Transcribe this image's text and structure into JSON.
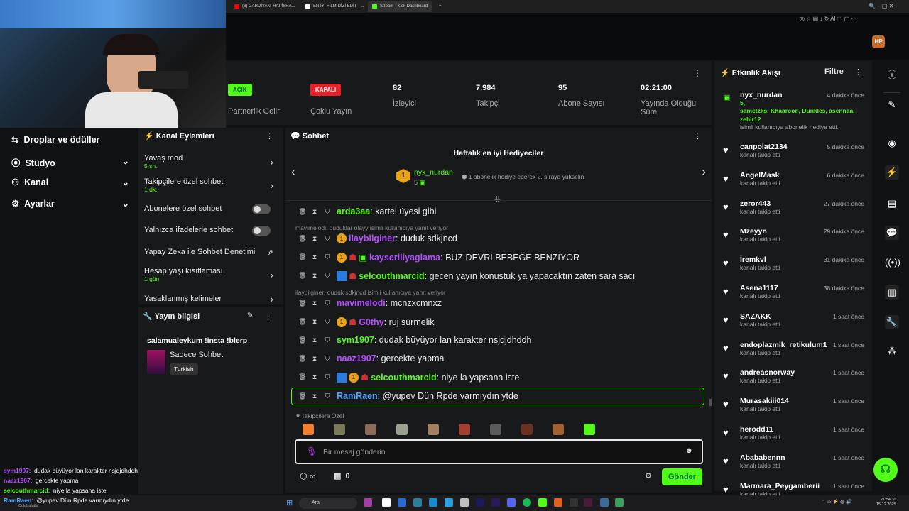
{
  "browser": {
    "tabs": [
      {
        "label": "(8) GARDİYAN, HAPİSHA...",
        "color": "#ff0000"
      },
      {
        "label": "EN İYİ FİLM-DİZİ EDİT - ...",
        "color": "#ffffff"
      },
      {
        "label": "Stream - Kick Dashboard",
        "color": "#53fc18"
      }
    ],
    "ai": "AI"
  },
  "leftnav": {
    "items": [
      "Droplar ve ödüller",
      "Stüdyo",
      "Kanal",
      "Ayarlar"
    ]
  },
  "stats": [
    {
      "badge": "AÇIK",
      "badge_color": "#53fc18",
      "label": "Partnerlik Gelir"
    },
    {
      "badge": "KAPALI",
      "badge_color": "#e8202a",
      "label": "Çoklu Yayın"
    },
    {
      "value": "82",
      "label": "İzleyici"
    },
    {
      "value": "7.984",
      "label": "Takipçi"
    },
    {
      "value": "95",
      "label": "Abone Sayısı"
    },
    {
      "value": "02:21:00",
      "label": "Yayında Olduğu Süre"
    }
  ],
  "channel_actions": {
    "title": "Kanal Eylemleri",
    "items": [
      {
        "label": "Yavaş mod",
        "sub": "5 sn."
      },
      {
        "label": "Takipçilere özel sohbet",
        "sub": "1 dk."
      },
      {
        "label": "Abonelere özel sohbet"
      },
      {
        "label": "Yalnızca ifadelerle sohbet"
      },
      {
        "label": "Yapay Zeka ile Sohbet Denetimi"
      },
      {
        "label": "Hesap yaşı kısıtlaması",
        "sub": "1 gün"
      },
      {
        "label": "Yasaklanmış kelimeler"
      }
    ]
  },
  "stream_info": {
    "title": "Yayın bilgisi",
    "stream_title": "salamualeykum !insta !blerp",
    "category": "Sadece Sohbet",
    "language": "Turkish"
  },
  "chat": {
    "title": "Sohbet",
    "top_gifters_title": "Haftalık en iyi Hediyeciler",
    "top_gifter": {
      "rank": "1",
      "name": "nyx_nurdan",
      "count": "5",
      "note": "1 abonelik hediye ederek 2. sıraya yükselin"
    },
    "messages": [
      {
        "user": "arda3aa",
        "color": "#53fc18",
        "text": "kartel üyesi gibi"
      },
      {
        "reply": "mavimelodi: duduklar olayy isimli kullanıcıya yanıt veriyor"
      },
      {
        "user": "ilaybilginer",
        "color": "#b44dff",
        "text": "duduk sdkjncd",
        "coin": "1"
      },
      {
        "user": "kayseriliyaglama",
        "color": "#b44dff",
        "text": "BUZ DEVRİ BEBEĞE BENZİYOR",
        "coin": "1"
      },
      {
        "user": "selcouthmarcid",
        "color": "#53fc18",
        "text": "gecen yayın konustuk ya yapacaktın zaten sara sacı"
      },
      {
        "reply": "ilaybilginer: duduk sdkjncd isimli kullanıcıya yanıt veriyor"
      },
      {
        "user": "mavimelodi",
        "color": "#b44dff",
        "text": "mcnzxcmnxz"
      },
      {
        "user": "G0thy",
        "color": "#b44dff",
        "text": "ruj sürmelik",
        "coin": "1"
      },
      {
        "user": "sym1907",
        "color": "#53fc18",
        "text": "dudak büyüyor lan karakter nsjdjdhddh"
      },
      {
        "user": "naaz1907",
        "color": "#b44dff",
        "text": "gercekte yapma"
      },
      {
        "user": "selcouthmarcid",
        "color": "#53fc18",
        "text": "niye la yapsana iste",
        "coin": "1"
      },
      {
        "user": "RamRaen",
        "color": "#4fa3ff",
        "text": "@yupev Dün Rpde varmıydın ytde"
      }
    ],
    "followers_label": "Takipçilere Özel",
    "input_placeholder": "Bir mesaj gönderin",
    "points": "∞",
    "drops": "0",
    "send": "Gönder"
  },
  "activity": {
    "title": "Etkinlik Akışı",
    "filter": "Filtre",
    "gift": {
      "name": "nyx_nurdan",
      "time": "4 dakika önce",
      "count": "5,",
      "recipients": "sametzks, Khaaroon, Dunkles, asennaa, zehir12",
      "text": "isimli kullanıcıya abonelik hediye etti."
    },
    "follows": [
      {
        "name": "canpolat2134",
        "time": "5 dakika önce"
      },
      {
        "name": "AngelMask",
        "time": "6 dakika önce"
      },
      {
        "name": "zeror443",
        "time": "27 dakika önce"
      },
      {
        "name": "Mzeyyn",
        "time": "29 dakika önce"
      },
      {
        "name": "İremkvl",
        "time": "31 dakika önce"
      },
      {
        "name": "Asena1117",
        "time": "38 dakika önce"
      },
      {
        "name": "SAZAKK",
        "time": "1 saat önce"
      },
      {
        "name": "endoplazmik_retikulum1",
        "time": "1 saat önce"
      },
      {
        "name": "andreasnorway",
        "time": "1 saat önce"
      },
      {
        "name": "Murasakiii014",
        "time": "1 saat önce"
      },
      {
        "name": "herodd11",
        "time": "1 saat önce"
      },
      {
        "name": "Abababennn",
        "time": "1 saat önce"
      },
      {
        "name": "Marmara_Peygamberii",
        "time": "1 saat önce"
      }
    ],
    "follow_text": "kanalı takip etti"
  },
  "overlay_chat": [
    {
      "user": "sym1907",
      "color": "#b44dff",
      "text": "dudak büyüyor lan karakter nsjdjdhddh"
    },
    {
      "user": "naaz1907",
      "color": "#b44dff",
      "text": "gercekte yapma"
    },
    {
      "user": "selcouthmarcid",
      "color": "#53fc18",
      "text": "niye la yapsana iste"
    },
    {
      "user": "RamRaen",
      "color": "#4fa3ff",
      "text": "@yupev Dün Rpde varmıydın ytde"
    }
  ],
  "taskbar": {
    "search": "Ara",
    "time": "21:54:30",
    "date": "15.12.2025",
    "weather": "Çok bulutlu"
  }
}
